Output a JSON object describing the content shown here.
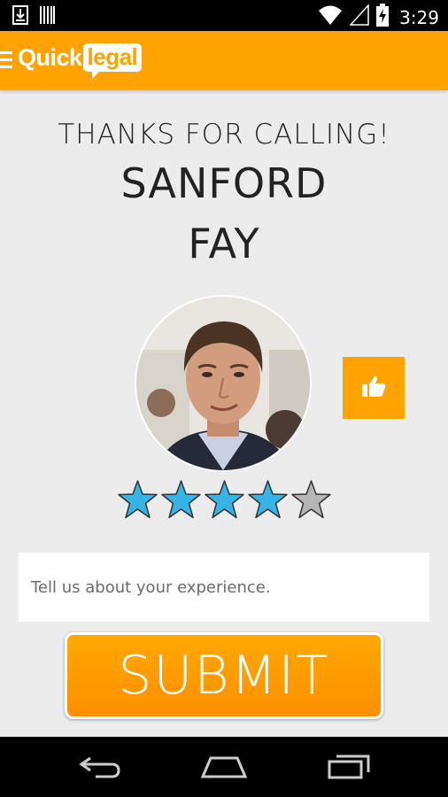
{
  "status_bar": {
    "time": "3:29",
    "icons": [
      "download-icon",
      "barcode-icon",
      "wifi-icon",
      "signal-icon",
      "battery-charging-icon"
    ]
  },
  "app_bar": {
    "menu_icon": "hamburger-menu-icon",
    "logo_part1": "Quick",
    "logo_part2": "legal"
  },
  "main": {
    "thanks_text": "THANKS FOR CALLING!",
    "name_line1": "SANFORD",
    "name_line2": "FAY",
    "like_icon": "thumbs-up-icon",
    "rating": {
      "value": 4,
      "max": 5,
      "filled_color": "#36b4e5",
      "empty_color": "#b5b5b5"
    },
    "feedback_placeholder": "Tell us about your experience.",
    "submit_label": "SUBMIT"
  },
  "nav_bar": {
    "icons": [
      "back-icon",
      "home-icon",
      "recent-apps-icon"
    ]
  },
  "colors": {
    "accent": "#ffa300",
    "background": "#ececec"
  }
}
